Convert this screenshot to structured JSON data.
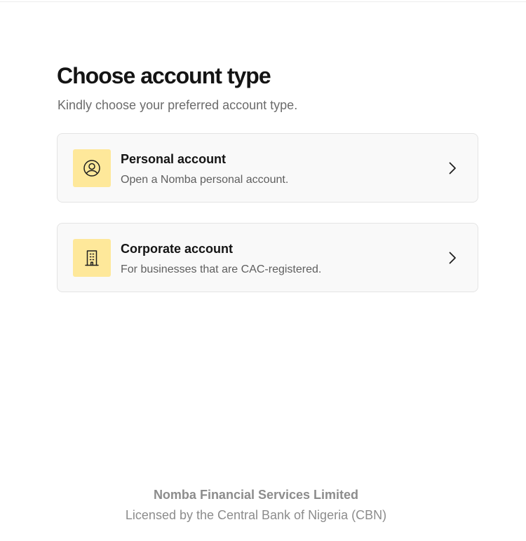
{
  "page": {
    "title": "Choose account type",
    "subtitle": "Kindly choose your preferred account type."
  },
  "options": [
    {
      "title": "Personal account",
      "description": "Open a Nomba personal account.",
      "icon": "user-circle-icon",
      "action_icon": "chevron-right-icon"
    },
    {
      "title": "Corporate account",
      "description": "For businesses that are CAC-registered.",
      "icon": "building-icon",
      "action_icon": "chevron-right-icon"
    }
  ],
  "footer": {
    "company": "Nomba Financial Services Limited",
    "license": "Licensed by the Central Bank of Nigeria (CBN)"
  },
  "colors": {
    "icon_tile_background": "#fee89a",
    "card_background": "#f9f9f9",
    "card_border": "#e4e4e4",
    "title_text": "#141414",
    "muted_text": "#8c8c8c"
  }
}
